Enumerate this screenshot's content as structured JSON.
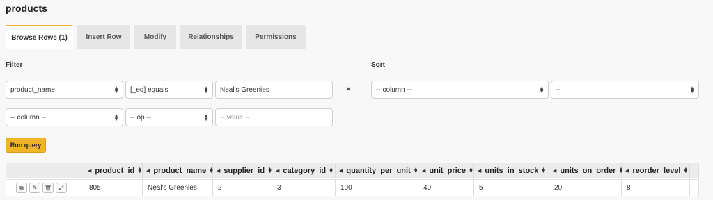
{
  "page": {
    "title": "products"
  },
  "tabs": [
    {
      "label": "Browse Rows (1)",
      "active": true
    },
    {
      "label": "Insert Row"
    },
    {
      "label": "Modify"
    },
    {
      "label": "Relationships"
    },
    {
      "label": "Permissions"
    }
  ],
  "filter": {
    "label": "Filter",
    "rows": [
      {
        "column": "product_name",
        "op": "[_eq] equals",
        "value": "Neal's Greenies"
      },
      {
        "column": "-- column --",
        "op": "-- op --",
        "value_placeholder": "-- value --"
      }
    ],
    "remove_symbol": "×"
  },
  "sort": {
    "label": "Sort",
    "column": "-- column --",
    "order": "--"
  },
  "run_query_label": "Run query",
  "table": {
    "columns": [
      "product_id",
      "product_name",
      "supplier_id",
      "category_id",
      "quantity_per_unit",
      "unit_price",
      "units_in_stock",
      "units_on_order",
      "reorder_level"
    ],
    "rows": [
      [
        "805",
        "Neal's Greenies",
        "2",
        "3",
        "100",
        "40",
        "5",
        "20",
        "8"
      ]
    ]
  },
  "row_actions": [
    "copy-icon",
    "edit-icon",
    "delete-icon",
    "expand-icon"
  ]
}
